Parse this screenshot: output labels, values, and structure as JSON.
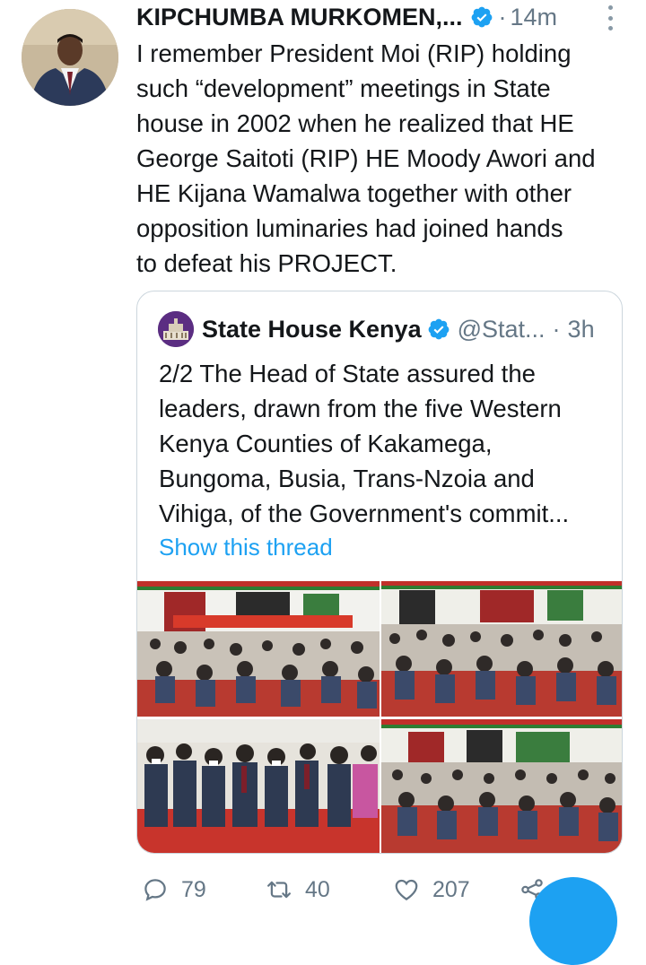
{
  "tweet": {
    "author_name": "KIPCHUMBA MURKOMEN,...",
    "separator": "·",
    "time": "14m",
    "text_lines": [
      "I remember President Moi (RIP) holding",
      "such “development” meetings in State",
      "house in 2002 when he realized that HE",
      "George Saitoti (RIP) HE Moody Awori and",
      "HE Kijana Wamalwa together with other",
      "opposition luminaries had joined hands",
      "to defeat his PROJECT."
    ]
  },
  "quoted": {
    "name": "State House Kenya",
    "handle": "@Stat...",
    "separator": "·",
    "time": "3h",
    "text_lines": [
      "2/2 The Head of State assured the",
      "leaders, drawn from the five Western",
      "Kenya Counties of Kakamega,",
      "Bungoma, Busia, Trans-Nzoia and",
      "Vihiga, of the Government's commit..."
    ],
    "show_thread": "Show this thread"
  },
  "actions": {
    "replies": "79",
    "retweets": "40",
    "likes": "207"
  },
  "icons": [
    "more-icon",
    "verified-icon",
    "reply-icon",
    "retweet-icon",
    "like-icon",
    "share-icon"
  ],
  "colors": {
    "accent": "#1da1f2",
    "muted": "#657786",
    "text": "#14171a",
    "border": "#ccd6dd"
  }
}
